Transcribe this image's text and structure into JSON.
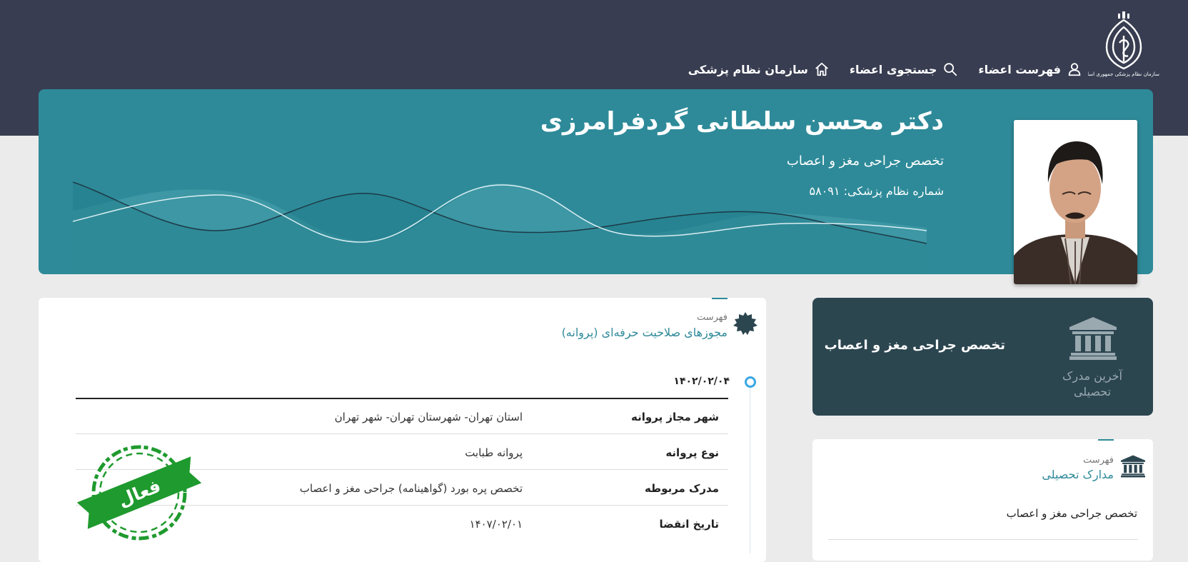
{
  "colors": {
    "header_bg": "#383d51",
    "hero_bg": "#2e8a99",
    "accent": "#2e8a99",
    "dark_card": "#2c4650",
    "stamp_green": "#1f9a2e"
  },
  "logo": {
    "icon": "medical-council-emblem",
    "caption": "سازمان نظام پزشکی جمهوری اسلامی ایران"
  },
  "nav": {
    "home": {
      "label": "سازمان نظام پزشکی",
      "icon": "home-icon"
    },
    "search": {
      "label": "جستجوی اعضاء",
      "icon": "search-icon"
    },
    "members": {
      "label": "فهرست اعضاء",
      "icon": "user-icon"
    }
  },
  "profile": {
    "name": "دکتر محسن سلطانی گردفرامرزی",
    "specialty": "تخصص جراحی مغز و اعصاب",
    "reg_number": "شماره نظام پزشکی: ۵۸۰۹۱"
  },
  "licenses": {
    "small_label": "فهرست",
    "title": "مجوزهای صلاحیت حرفه‌ای (پروانه)",
    "date": "۱۴۰۲/۰۲/۰۴",
    "rows": [
      {
        "label": "شهر مجاز پروانه",
        "value": "استان تهران- شهرستان تهران- شهر تهران"
      },
      {
        "label": "نوع پروانه",
        "value": "پروانه طبابت"
      },
      {
        "label": "مدرک مربوطه",
        "value": "تخصص پره بورد (گواهینامه) جراحی مغز و اعصاب"
      },
      {
        "label": "تاریخ انقضا",
        "value": "۱۴۰۷/۰۲/۰۱"
      }
    ],
    "stamp": "فعال"
  },
  "last_degree": {
    "label_line1": "آخرین مدرک",
    "label_line2": "تحصیلی",
    "value": "تخصص جراحی مغز و اعصاب"
  },
  "education": {
    "small_label": "فهرست",
    "title": "مدارک تحصیلی",
    "items": [
      "تخصص جراحی مغز و اعصاب"
    ]
  }
}
